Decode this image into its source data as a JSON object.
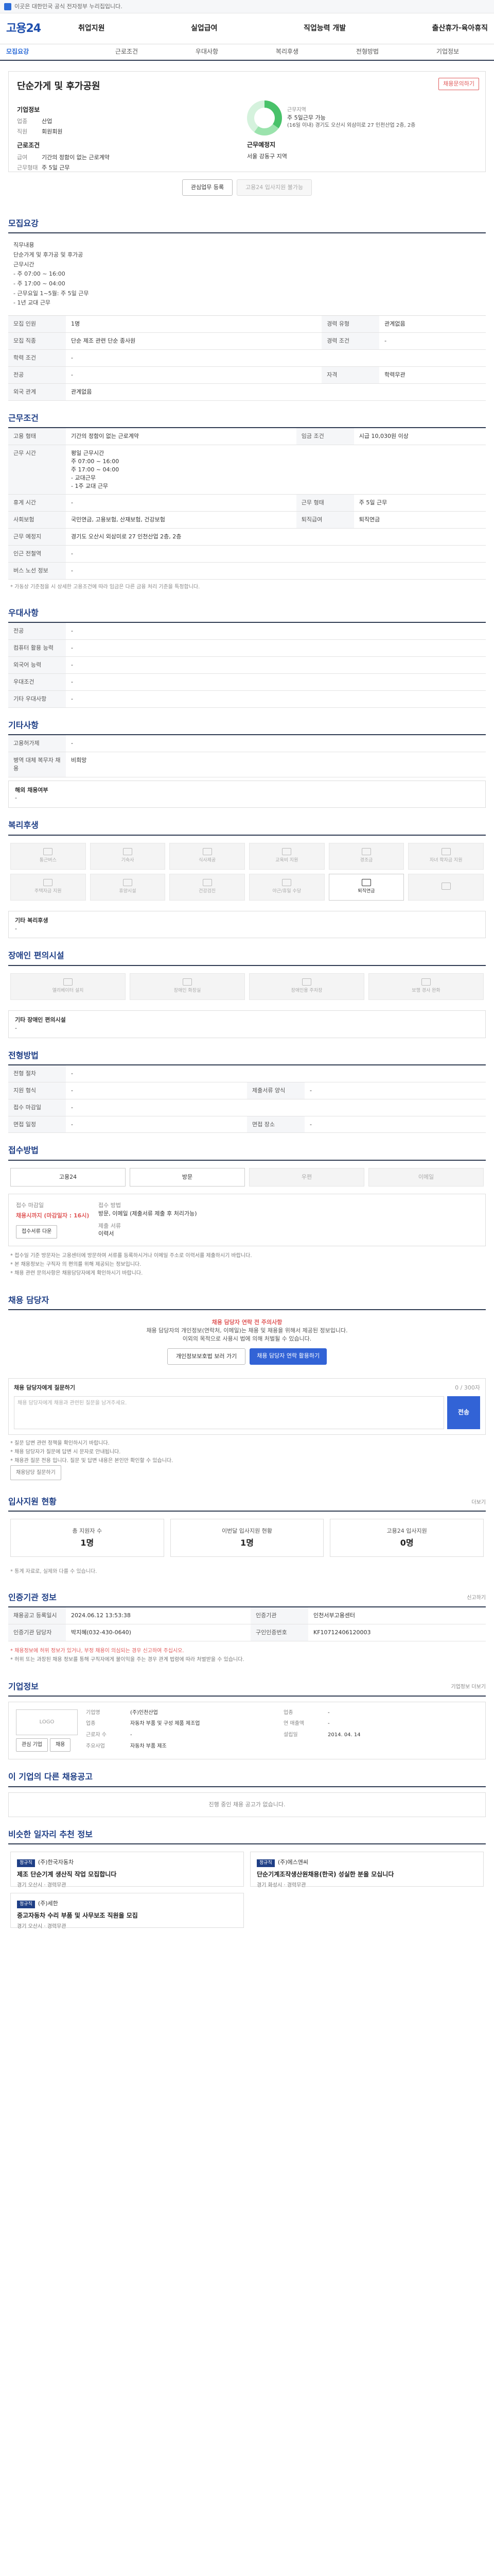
{
  "topbar": {
    "text": "이곳은 대한민국 공식 전자정부 누리집입니다."
  },
  "logo": "고용24",
  "nav": [
    "취업지원",
    "실업급여",
    "직업능력 개발",
    "출산휴가·육아휴직"
  ],
  "tabs": [
    "모집요강",
    "근로조건",
    "우대사항",
    "복리후생",
    "전형방법",
    "기업정보"
  ],
  "hero": {
    "title": "단순가게 및 후가공원",
    "report": "채용문의하기",
    "company_h": "기업정보",
    "company": [
      {
        "k": "업종",
        "v": "산업"
      },
      {
        "k": "직원",
        "v": "회원회원"
      }
    ],
    "cond_h": "근로조건",
    "cond": [
      {
        "k": "급여",
        "v": "기간의 정함이 없는 근로계약"
      },
      {
        "k": "근무형태",
        "v": "주 5일 근무"
      }
    ],
    "donut_label": "근무지역",
    "donut_text": "주 5일근무 가능",
    "apply_h": "지원자격",
    "apply": [
      {
        "k": "경력",
        "v": "관계없음"
      },
      {
        "k": "학력",
        "v": "학력무관"
      }
    ],
    "place_h": "근무예정지",
    "place": "(16일 이내) 경기도 오산시 외삼미로 27 인천산업 2층, 2층",
    "place2": "서울 강동구 지역"
  },
  "actions": {
    "save": "관심업무 등록",
    "apply": "고용24 입사지원 불가능"
  },
  "recruit": {
    "title": "모집요강",
    "content": [
      "직무내용",
      "단순가게 및 후가공 및 후가공",
      "근무시간",
      "- 주 07:00 ~ 16:00",
      "- 주 17:00 ~ 04:00",
      "- 근무요일 1~5월: 주 5일 근무",
      "- 1년 교대 근무"
    ],
    "rows": [
      {
        "a": "모집 인원",
        "av": "1명",
        "b": "경력 유형",
        "bv": "관계없음"
      },
      {
        "a": "모집 직종",
        "av": "단순 제조 관련 단순 종사원",
        "b": "경력 조건",
        "bv": "-"
      },
      {
        "a": "학력 조건",
        "av": "-",
        "b": "",
        "bv": ""
      },
      {
        "a": "전공",
        "av": "-",
        "b": "자격",
        "bv": "학력무관"
      },
      {
        "a": "외국 관계",
        "av": "관계없음",
        "b": "",
        "bv": ""
      }
    ]
  },
  "work": {
    "title": "근무조건",
    "rows": [
      {
        "a": "고용 형태",
        "av": "기간의 정함이 없는 근로계약",
        "b": "임금 조건",
        "bv": "시급 10,030원 이상"
      },
      {
        "a": "근무 시간",
        "av": "평일 근무시간\n주 07:00 ~ 16:00\n주 17:00 ~ 04:00\n- 교대근무\n- 1주 교대 근무",
        "b": "",
        "bv": ""
      },
      {
        "a": "휴게 시간",
        "av": "-",
        "b": "근무 형태",
        "bv": "주 5일 근무"
      },
      {
        "a": "사회보험",
        "av": "국민연금, 고용보험, 산재보험, 건강보험",
        "b": "퇴직급여",
        "bv": "퇴직연금"
      },
      {
        "a": "근무 예정지",
        "av": "경기도 오산시 외삼미로 27 인천산업 2층, 2층",
        "b": "",
        "bv": ""
      },
      {
        "a": "인근 전철역",
        "av": "-",
        "b": "",
        "bv": ""
      },
      {
        "a": "버스 노선 정보",
        "av": "-",
        "b": "",
        "bv": ""
      }
    ],
    "note": "* 가동상 기준점을 시 상세한 고용조건에 따라 임금은 다른 금융 처리 기준을 특정합니다."
  },
  "prefer": {
    "title": "우대사항",
    "rows": [
      {
        "k": "전공",
        "v": "-"
      },
      {
        "k": "컴퓨터 활용 능력",
        "v": "-"
      },
      {
        "k": "외국어 능력",
        "v": "-"
      },
      {
        "k": "우대조건",
        "v": "-"
      },
      {
        "k": "기타 우대사항",
        "v": "-"
      }
    ]
  },
  "etc": {
    "title": "기타사항",
    "rows": [
      {
        "k": "고용허가제",
        "v": "-"
      },
      {
        "k": "병역 대체 복무자 채용",
        "v": "비희망"
      }
    ],
    "sub": "해외 채용여부",
    "sub_v": "-"
  },
  "welfare": {
    "title": "복리후생",
    "items": [
      "통근버스",
      "기숙사",
      "식사제공",
      "교육비 지원",
      "경조금",
      "자녀 학자금 지원",
      "주택자금 지원",
      "휴양시설",
      "건강검진",
      "야근/휴일 수당",
      "퇴직연금",
      ""
    ],
    "active": [
      10
    ],
    "sub": "기타 복리후생",
    "sub_v": "-"
  },
  "access": {
    "title": "장애인 편의시설",
    "items": [
      "엘리베이터 설치",
      "장애인 화장실",
      "장애인용 주차장",
      "보행 경사 완화"
    ],
    "sub": "기타 장애인 편의시설",
    "sub_v": "-"
  },
  "screen": {
    "title": "전형방법",
    "rows": [
      {
        "a": "전형 절차",
        "av": "-",
        "b": "",
        "bv": ""
      },
      {
        "a": "지원 형식",
        "av": "-",
        "b": "제출서류 양식",
        "bv": "-"
      },
      {
        "a": "접수 마감일",
        "av": "-",
        "b": "",
        "bv": ""
      },
      {
        "a": "면접 일정",
        "av": "-",
        "b": "면접 장소",
        "bv": "-"
      }
    ]
  },
  "method": {
    "title": "접수방법",
    "items": [
      "고용24",
      "방문",
      "우편",
      "이메일"
    ],
    "active": [
      0,
      1
    ],
    "deadline_l": "접수 마감일",
    "deadline": "채용시까지 (마감일자 : 16시)",
    "docs_l": "접수 방법",
    "docs": "방문, 이메일 (제출서류 제출 후 처리가능)",
    "fee_l": "제출 서류",
    "fee": "이력서",
    "doc_btn": "접수서류 다운",
    "notes": [
      "* 접수일 기준 방문자는 고용센터에 방문하여 서류를 등록하시거나 이메일 주소로 이력서를 제출하시기 바랍니다.",
      "* 본 채용정보는 구직자 의 편의를 위해 제공되는 정보입니다.",
      "* 채용 관련 문의사항은 채용담당자에게 확인하시기 바랍니다."
    ]
  },
  "manager": {
    "title": "채용 담당자",
    "alert": "채용 담당자 연락 전 주의사항",
    "desc": "채용 담당자의 개인정보(연락처, 이메일)는 채용 및 채용을 위해서 제공된 정보입니다.",
    "desc2": "이외의 목적으로 사용시 법에 의해 처벌될 수 있습니다.",
    "btn1": "개인정보보호법 보러 가기",
    "btn2": "채용 담당자 연락 활용하기",
    "q_title": "채용 담당자에게 질문하기",
    "q_count": "0 / 300자",
    "q_placeholder": "채용 담당자에게 채용과 관련된 질문을 남겨주세요.",
    "q_send": "전송",
    "q_notes": [
      "* 질문 답변 관련 정책을 확인하시기 바랍니다.",
      "* 채용 담당자가 질문에 답변 시 문자로 안내됩니다.",
      "* 채용관 질문 전용 입니다. 질문 및 답변 내용은 본인만 확인할 수 있습니다."
    ],
    "q_more": "채용담당 질문하기"
  },
  "status": {
    "title": "입사지원 현황",
    "more": "더보기",
    "cards": [
      {
        "l": "총 지원자 수",
        "v": "1명"
      },
      {
        "l": "이번달 입사지원 현황",
        "v": "1명"
      },
      {
        "l": "고용24 입사지원",
        "v": "0명"
      }
    ],
    "note": "* 통계 자료로, 실제와 다를 수 있습니다."
  },
  "reginfo": {
    "title": "인증기관 정보",
    "more": "신고하기",
    "rows": [
      {
        "a": "채용공고 등록일시",
        "av": "2024.06.12 13:53:38",
        "b": "인증기관",
        "bv": "인천서부고용센터"
      },
      {
        "a": "인증기관 담당자",
        "av": "박지혜(032-430-0640)",
        "b": "구인인증번호",
        "bv": "KF10712406120003"
      }
    ],
    "notes": [
      "* 채용정보에 허위 정보가 있거나, 부정 채용이 의심되는 경우 신고하여 주십시오.",
      "* 허위 또는 과장된 채용 정보를 통해 구직자에게 불이익을 주는 경우 관계 법령에 따라 처벌받을 수 있습니다."
    ]
  },
  "company": {
    "title": "기업정보",
    "more": "기업정보 더보기",
    "logo": "LOGO",
    "btn1": "관심 기업",
    "btn2": "채용",
    "info": [
      {
        "k": "기업명",
        "v": "(주)인천산업"
      },
      {
        "k": "업종",
        "v": "-"
      },
      {
        "k": "업종",
        "v": "자동차 부품 및 구성 제품 제조업"
      },
      {
        "k": "연 매출액",
        "v": "-"
      },
      {
        "k": "근로자 수",
        "v": "-"
      },
      {
        "k": "설립일",
        "v": "2014. 04. 14"
      },
      {
        "k": "주요사업",
        "v": "자동차 부품 제조"
      },
      {
        "k": "",
        "v": ""
      }
    ]
  },
  "others": {
    "title": "이 기업의 다른 채용공고",
    "more": "",
    "empty": "진행 중인 채용 공고가 없습니다."
  },
  "recommend": {
    "title": "비슷한 일자리 추천 정보",
    "cards": [
      {
        "badge": "정규직",
        "co": "(주)한국자동차",
        "title": "제조 단순기계 생산직 작업 모집합니다",
        "sub": "경기 오산시 · 경력무관"
      },
      {
        "badge": "정규직",
        "co": "(주)에스앤씨",
        "title": "단순기계조작생산원채용(한국) 성실한 분을 모십니다",
        "sub": "경기 화성시 · 경력무관"
      },
      {
        "badge": "정규직",
        "co": "(주)세한",
        "title": "중고자동차 수리 부품 및 사무보조 직원을 모집",
        "sub": "경기 오산시 · 경력무관"
      }
    ]
  }
}
